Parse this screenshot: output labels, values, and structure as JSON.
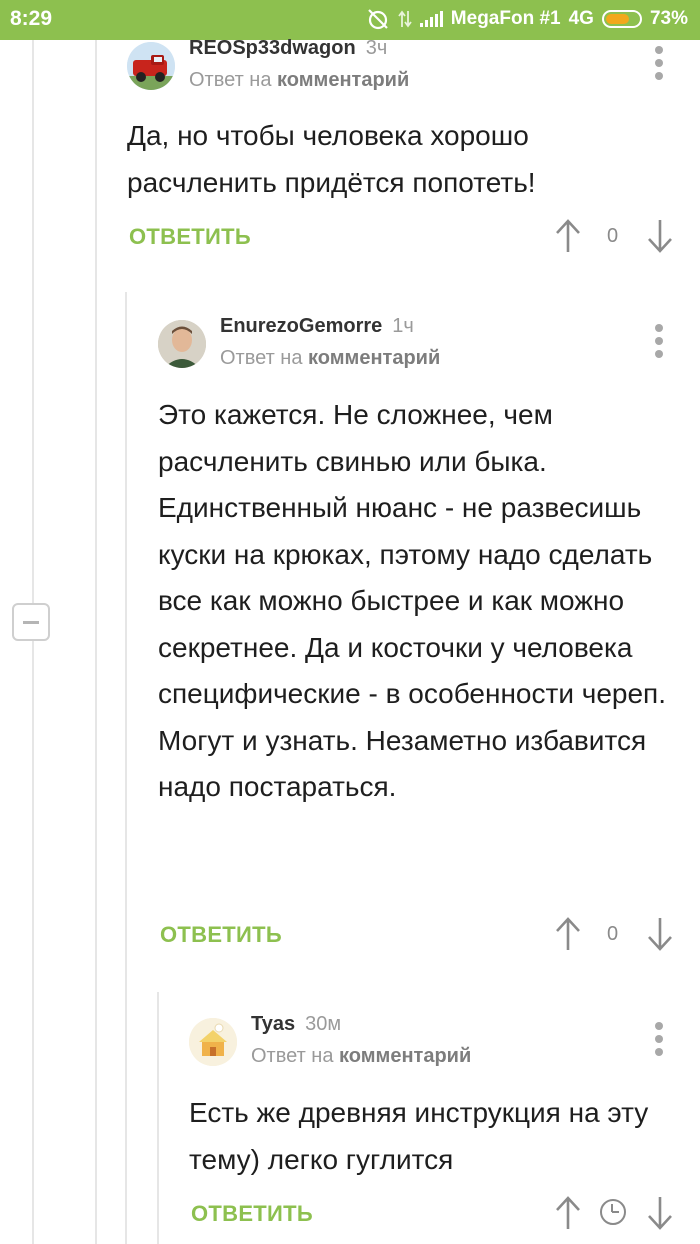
{
  "status_bar": {
    "time": "8:29",
    "carrier": "MegaFon #1",
    "network": "4G",
    "battery": "73%",
    "battery_level": 0.73
  },
  "reply_label": "ОТВЕТИТЬ",
  "reply_to_prefix": "Ответ на",
  "reply_to_target": "комментарий",
  "comments": [
    {
      "author": "REOSp33dwagon",
      "age": "3ч",
      "text": "Да, но чтобы человека хорошо расчленить придётся попотеть!",
      "score": "0",
      "avatar": "red-truck"
    },
    {
      "author": "EnurezoGemorre",
      "age": "1ч",
      "text": "Это кажется. Не сложнее, чем расчленить свинью или быка. Единственный нюанс - не развесишь куски на крюках, пэтому надо сделать все как можно быстрее и как можно секретнее. Да и косточки у человека специфические - в особенности череп. Могут и узнать. Незаметно избавится надо постараться.",
      "score": "0",
      "avatar": "man-photo"
    },
    {
      "author": "Tyas",
      "age": "30м",
      "text": "Есть же древняя инструкция на эту тему) легко гуглится",
      "score": "",
      "avatar": "cartoon-house"
    }
  ],
  "colors": {
    "status_bar": "#8dc04f",
    "accent": "#8dc04f",
    "meta_text": "#9a9a9a"
  }
}
